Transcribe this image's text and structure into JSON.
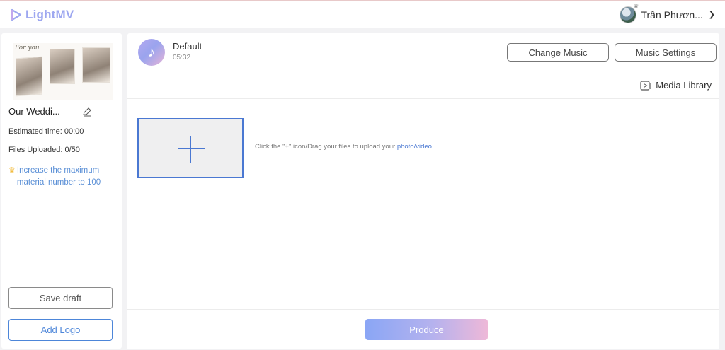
{
  "app": {
    "name": "LightMV",
    "brand_color": "#9da7f0"
  },
  "user": {
    "name": "Trần Phươn...",
    "avatar": "avatar"
  },
  "sidebar": {
    "template_thumbnail_title": "For you",
    "project_name": "Our Weddi...",
    "estimated_time": "Estimated time: 00:00",
    "files_uploaded": "Files Uploaded: 0/50",
    "upgrade_text": "Increase the maximum material number to 100",
    "upgrade_icon": "crown-icon",
    "save_draft_label": "Save draft",
    "add_logo_label": "Add Logo"
  },
  "music": {
    "name": "Default",
    "duration": "05:32",
    "change_label": "Change Music",
    "settings_label": "Music Settings"
  },
  "media_library_label": "Media Library",
  "upload": {
    "hint_prefix": "Click the \"+\" icon/Drag your files to upload your ",
    "hint_link": "photo/video"
  },
  "produce_label": "Produce",
  "colors": {
    "accent_blue": "#4a78d2",
    "link_blue": "#5a8fd6",
    "produce_gradient_start": "#8aa6f5",
    "produce_gradient_end": "#eeb8d8"
  }
}
